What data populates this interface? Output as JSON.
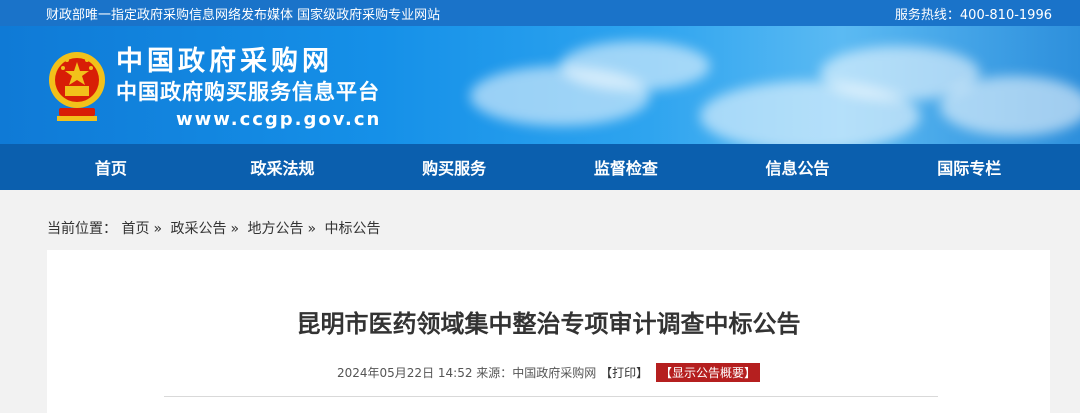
{
  "topbar": {
    "left_text": "财政部唯一指定政府采购信息网络发布媒体 国家级政府采购专业网站",
    "hotline": "服务热线：400-810-1996"
  },
  "logo": {
    "title_cn": "中国政府采购网",
    "subtitle_cn": "中国政府购买服务信息平台",
    "url": "www.ccgp.gov.cn"
  },
  "nav": {
    "items": [
      "首页",
      "政采法规",
      "购买服务",
      "监督检查",
      "信息公告",
      "国际专栏"
    ]
  },
  "breadcrumb": {
    "prefix": "当前位置：",
    "items": [
      "首页",
      "政采公告",
      "地方公告",
      "中标公告"
    ],
    "separator": "»"
  },
  "article": {
    "title": "昆明市医药领域集中整治专项审计调查中标公告",
    "datetime": "2024年05月22日 14:52",
    "source": "来源：中国政府采购网",
    "print": "【打印】",
    "summary_button": "【显示公告概要】"
  },
  "colors": {
    "topbar": "#1a73c9",
    "nav": "#0b5fae",
    "summary_badge": "#b51f1f"
  }
}
